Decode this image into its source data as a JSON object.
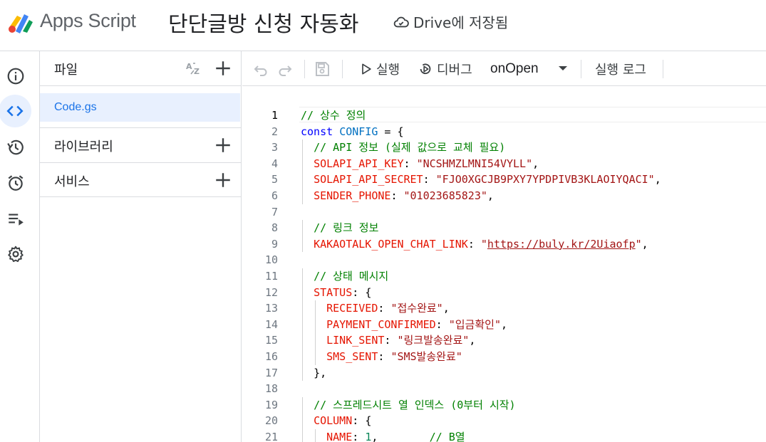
{
  "header": {
    "app_name": "Apps Script",
    "project_title": "단단글방 신청 자동화",
    "save_status": "Drive에 저장됨"
  },
  "rail": {
    "items": [
      {
        "name": "overview",
        "icon": "info-icon"
      },
      {
        "name": "editor",
        "icon": "code-icon",
        "active": true
      },
      {
        "name": "versions",
        "icon": "history-icon"
      },
      {
        "name": "triggers",
        "icon": "alarm-icon"
      },
      {
        "name": "executions",
        "icon": "list-run-icon"
      },
      {
        "name": "settings",
        "icon": "gear-icon"
      }
    ]
  },
  "files": {
    "title": "파일",
    "items": [
      {
        "name": "Code.gs",
        "selected": true
      }
    ],
    "libraries_label": "라이브러리",
    "services_label": "서비스"
  },
  "toolbar": {
    "run_label": "실행",
    "debug_label": "디버그",
    "function_name": "onOpen",
    "log_label": "실행 로그"
  },
  "editor": {
    "current_line": 1,
    "lines": [
      {
        "n": "1",
        "text": "// 상수 정의"
      },
      {
        "n": "2",
        "text": "const CONFIG = {"
      },
      {
        "n": "3",
        "text": "  // API 정보 (실제 값으로 교체 필요)"
      },
      {
        "n": "4",
        "text": "  SOLAPI_API_KEY: \"NCSHMZLMNI54VYLL\","
      },
      {
        "n": "5",
        "text": "  SOLAPI_API_SECRET: \"FJO0XGCJB9PXY7YPDPIVB3KLAOIYQACI\","
      },
      {
        "n": "6",
        "text": "  SENDER_PHONE: \"01023685823\","
      },
      {
        "n": "7",
        "text": ""
      },
      {
        "n": "8",
        "text": "  // 링크 정보"
      },
      {
        "n": "9",
        "text": "  KAKAOTALK_OPEN_CHAT_LINK: \"https://buly.kr/2Uiaofp\","
      },
      {
        "n": "10",
        "text": ""
      },
      {
        "n": "11",
        "text": "  // 상태 메시지"
      },
      {
        "n": "12",
        "text": "  STATUS: {"
      },
      {
        "n": "13",
        "text": "    RECEIVED: \"접수완료\","
      },
      {
        "n": "14",
        "text": "    PAYMENT_CONFIRMED: \"입금확인\","
      },
      {
        "n": "15",
        "text": "    LINK_SENT: \"링크발송완료\","
      },
      {
        "n": "16",
        "text": "    SMS_SENT: \"SMS발송완료\""
      },
      {
        "n": "17",
        "text": "  },"
      },
      {
        "n": "18",
        "text": ""
      },
      {
        "n": "19",
        "text": "  // 스프레드시트 열 인덱스 (0부터 시작)"
      },
      {
        "n": "20",
        "text": "  COLUMN: {"
      },
      {
        "n": "21",
        "text": "    NAME: 1,        // B열"
      }
    ]
  },
  "colors": {
    "accent": "#1a73e8",
    "selected_bg": "#e8f0fe",
    "border": "#dadce0",
    "comment": "#008000",
    "keyword": "#0000ff",
    "property": "#e51400",
    "string": "#a31515",
    "number": "#098658"
  }
}
